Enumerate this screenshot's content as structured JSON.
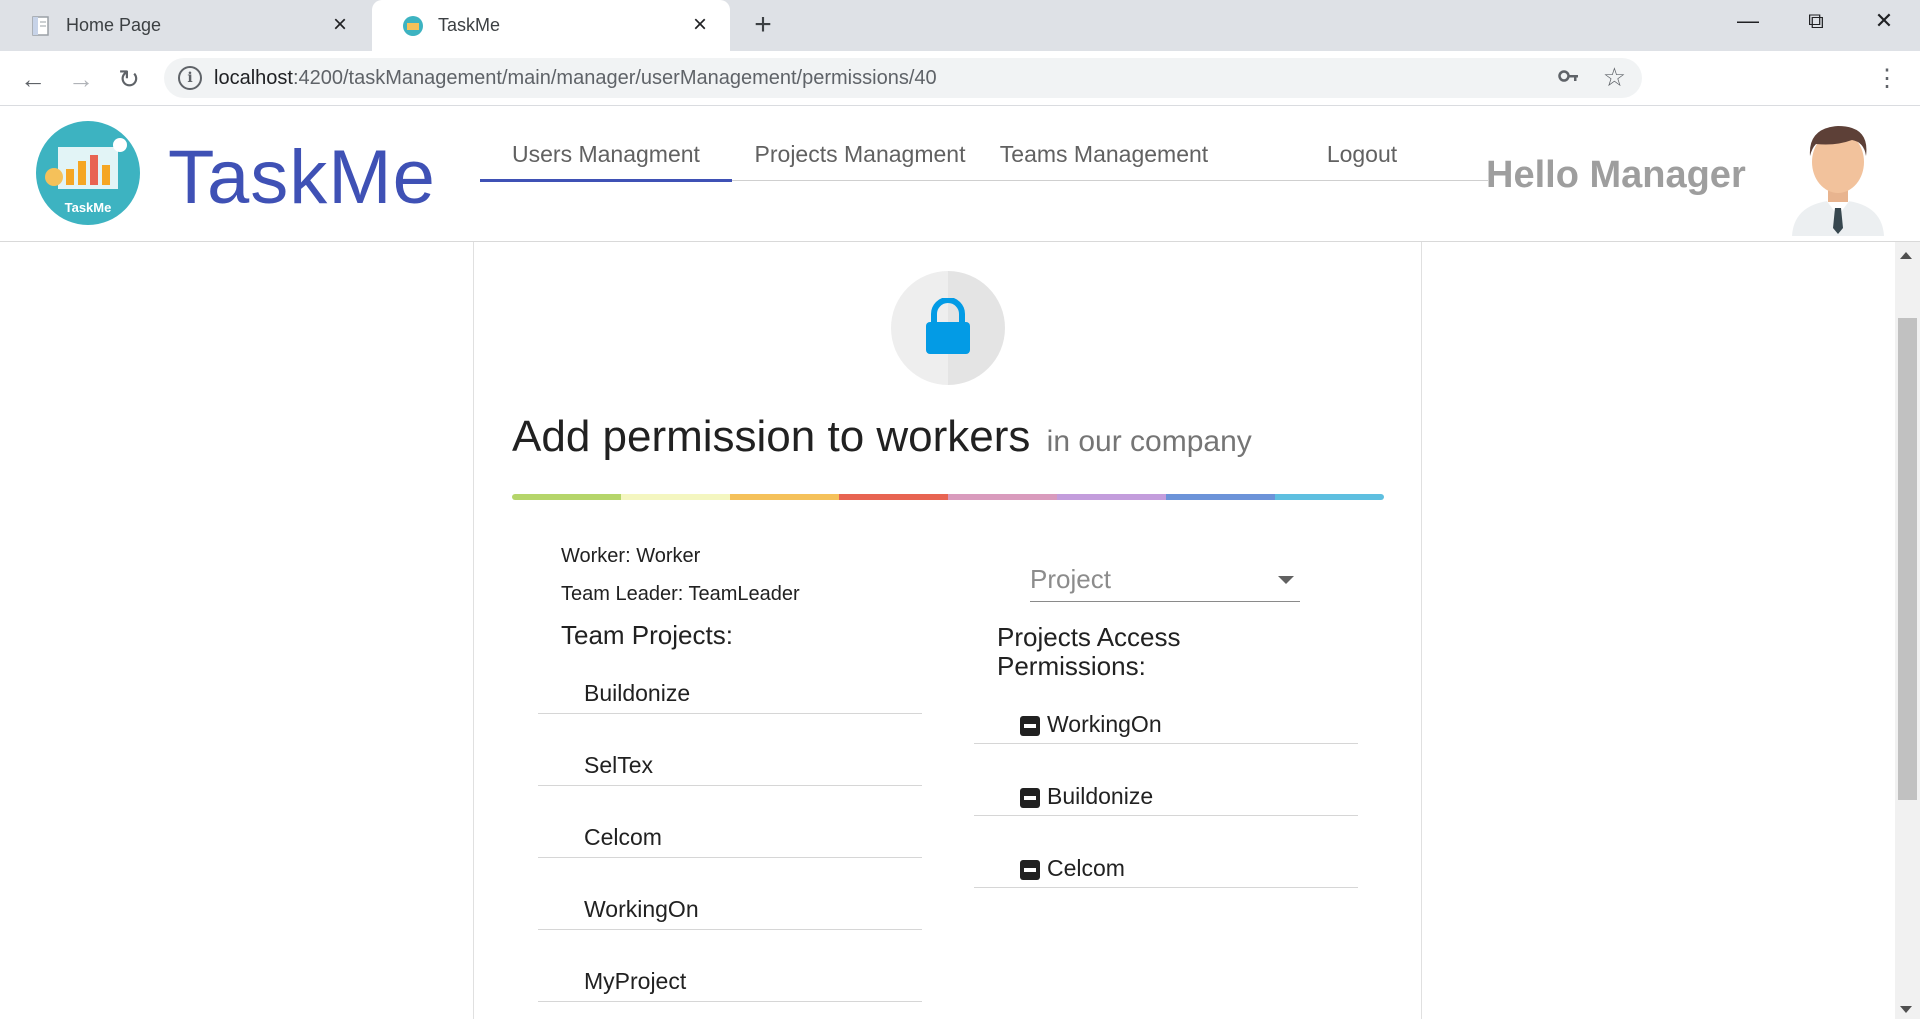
{
  "browser": {
    "tabs": [
      {
        "title": "Home Page",
        "active": false
      },
      {
        "title": "TaskMe",
        "active": true
      }
    ],
    "url_host": "localhost",
    "url_rest": ":4200/taskManagement/main/manager/userManagement/permissions/40"
  },
  "header": {
    "logo_text": "TaskMe",
    "brand": "TaskMe",
    "nav": [
      {
        "label": "Users Managment",
        "active": true
      },
      {
        "label": "Projects Managment",
        "active": false
      },
      {
        "label": "Teams Management",
        "active": false
      },
      {
        "label": "Logout",
        "active": false
      }
    ],
    "greeting": "Hello Manager"
  },
  "page": {
    "title": "Add permission to workers",
    "subtitle": "in our company",
    "rainbow_colors": [
      "#b5d56a",
      "#f4f6c0",
      "#f5c15a",
      "#e86452",
      "#d99bbd",
      "#c39ddc",
      "#6c93d9",
      "#5ebfe0"
    ],
    "worker_line": "Worker: Worker",
    "team_leader_line": "Team Leader: TeamLeader",
    "team_projects_heading": "Team Projects:",
    "team_projects": [
      "Buildonize",
      "SelTex",
      "Celcom",
      "WorkingOn",
      "MyProject"
    ],
    "project_select_placeholder": "Project",
    "access_heading": "Projects Access Permissions:",
    "access_permissions": [
      "WorkingOn",
      "Buildonize",
      "Celcom"
    ],
    "lock_color": "#039be5"
  }
}
